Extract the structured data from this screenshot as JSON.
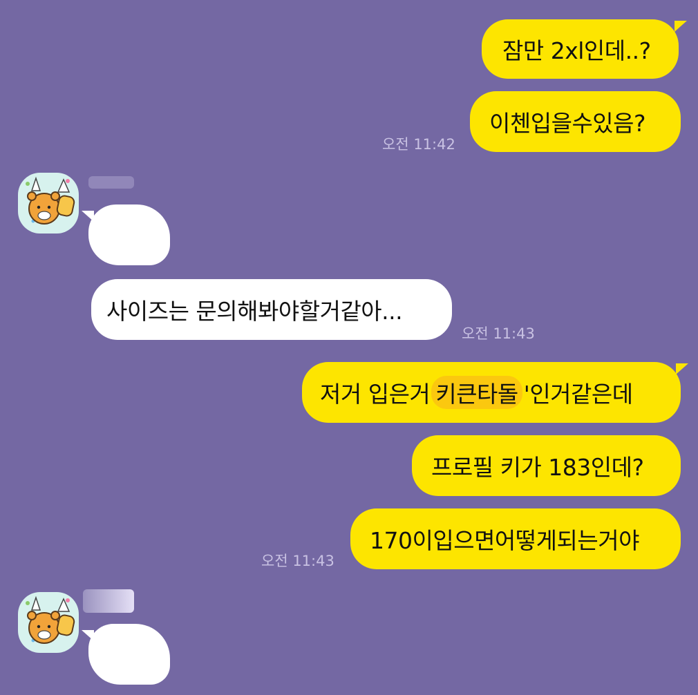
{
  "chat": {
    "messages": [
      {
        "text": "잠만 2xl인데..?"
      },
      {
        "text": "이첸입을수있음?",
        "time": "오전 11:42"
      },
      {
        "text": "사이즈는 문의해봐야할거같아...",
        "time": "오전 11:43"
      },
      {
        "text_before": "저거 입은거 ",
        "highlight": "키큰타돌",
        "text_after": "'인거같은데"
      },
      {
        "text": "프로필 키가 183인데?"
      },
      {
        "text": "170이입으면어떻게되는거야",
        "time": "오전 11:43"
      }
    ]
  },
  "colors": {
    "background": "#7468A3",
    "my_bubble": "#FDE500",
    "their_bubble": "#FFFFFF",
    "highlight": "#FABE14",
    "timestamp": "#C9C2E3"
  },
  "avatar": {
    "icon": "bear-character-avatar-icon"
  }
}
